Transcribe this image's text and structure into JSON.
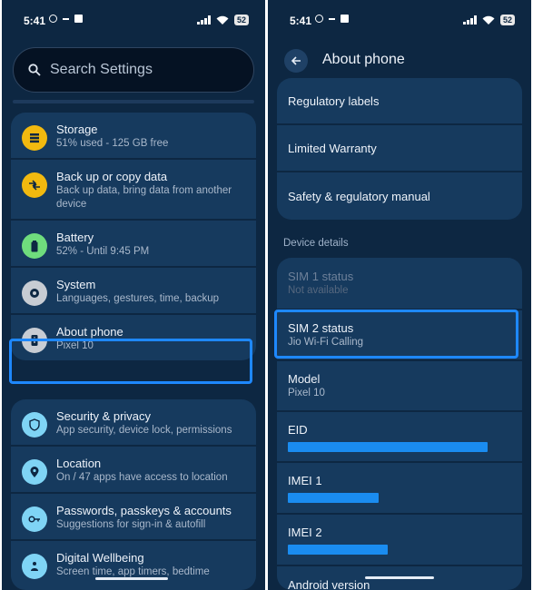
{
  "status_bar": {
    "time": "5:41",
    "battery": "52"
  },
  "left": {
    "search": {
      "placeholder": "Search Settings"
    },
    "group1": [
      {
        "title": "Storage",
        "sub": "51% used - 125 GB free",
        "icon": "storage-icon",
        "color": "#f2b90f"
      },
      {
        "title": "Back up or copy data",
        "sub": "Back up data, bring data from another device",
        "icon": "backup-icon",
        "color": "#f2b90f"
      },
      {
        "title": "Battery",
        "sub": "52% - Until 9:45 PM",
        "icon": "battery-icon",
        "color": "#6fdc7d"
      },
      {
        "title": "System",
        "sub": "Languages, gestures, time, backup",
        "icon": "gear-icon",
        "color": "#c7ccd3"
      },
      {
        "title": "About phone",
        "sub": "Pixel 10",
        "icon": "phone-info-icon",
        "color": "#c7ccd3"
      }
    ],
    "group2": [
      {
        "title": "Security & privacy",
        "sub": "App security, device lock, permissions",
        "icon": "shield-icon",
        "color": "#7fd4f5"
      },
      {
        "title": "Location",
        "sub": "On / 47 apps have access to location",
        "icon": "location-pin-icon",
        "color": "#7fd4f5"
      },
      {
        "title": "Passwords, passkeys & accounts",
        "sub": "Suggestions for sign-in & autofill",
        "icon": "key-icon",
        "color": "#7fd4f5"
      },
      {
        "title": "Digital Wellbeing",
        "sub": "Screen time, app timers, bedtime",
        "icon": "wellbeing-icon",
        "color": "#7fd4f5"
      }
    ]
  },
  "right": {
    "title": "About phone",
    "group1": [
      {
        "title": "Regulatory labels"
      },
      {
        "title": "Limited Warranty"
      },
      {
        "title": "Safety & regulatory manual"
      }
    ],
    "section_label": "Device details",
    "group2": [
      {
        "title": "SIM 1 status",
        "sub": "Not available",
        "disabled": true
      },
      {
        "title": "SIM 2 status",
        "sub": "Jio Wi-Fi Calling"
      },
      {
        "title": "Model",
        "sub": "Pixel 10"
      },
      {
        "title": "EID",
        "redacted": true
      },
      {
        "title": "IMEI 1",
        "redacted": true
      },
      {
        "title": "IMEI 2",
        "redacted": true
      },
      {
        "title": "Android version"
      }
    ]
  },
  "colors": {
    "background": "#0d2742",
    "card": "#163a5e",
    "highlight": "#1e88ff",
    "redaction": "#1a8cf0"
  }
}
